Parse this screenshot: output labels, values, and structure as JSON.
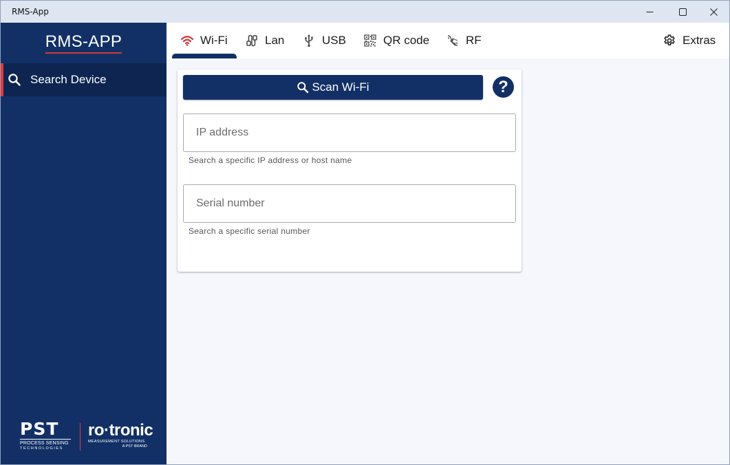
{
  "window": {
    "title": "RMS-App"
  },
  "sidebar": {
    "brand": "RMS-APP",
    "items": [
      {
        "label": "Search Device",
        "icon": "search-icon",
        "active": true
      }
    ],
    "logos": {
      "pst_big": "PST",
      "pst_line1": "PROCESS SENSING",
      "pst_line2": "TECHNOLOGIES",
      "roto_big": "ro·tronic",
      "roto_line1": "MEASUREMENT SOLUTIONS",
      "roto_line2": "A PST BRAND"
    }
  },
  "tabs": [
    {
      "label": "Wi-Fi",
      "icon": "wifi-icon",
      "active": true
    },
    {
      "label": "Lan",
      "icon": "lan-cable-icon"
    },
    {
      "label": "USB",
      "icon": "usb-icon"
    },
    {
      "label": "QR code",
      "icon": "qr-code-icon"
    },
    {
      "label": "RF",
      "icon": "rf-signal-icon"
    }
  ],
  "extras": {
    "label": "Extras",
    "icon": "gear-icon"
  },
  "card": {
    "scan_label": "Scan Wi-Fi",
    "help_label": "?",
    "ip": {
      "placeholder": "IP address",
      "value": "",
      "hint": "Search a specific IP address or host name"
    },
    "serial": {
      "placeholder": "Serial number",
      "value": "",
      "hint": "Search a specific serial number"
    }
  },
  "colors": {
    "primary": "#123066",
    "accent": "#e03c3c",
    "background": "#f5f7fd"
  }
}
